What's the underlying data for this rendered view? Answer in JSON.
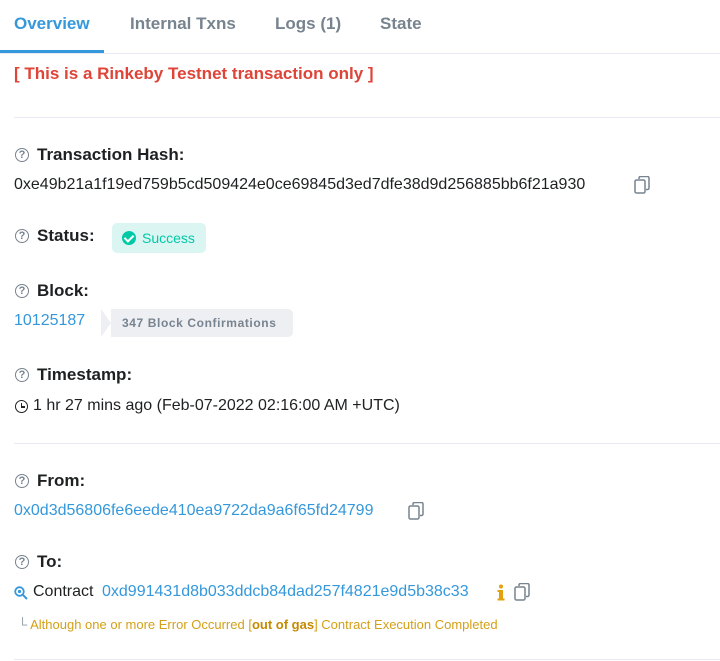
{
  "tabs": [
    {
      "label": "Overview",
      "active": true
    },
    {
      "label": "Internal Txns",
      "active": false
    },
    {
      "label": "Logs (1)",
      "active": false
    },
    {
      "label": "State",
      "active": false
    }
  ],
  "network_notice": "[ This is a Rinkeby Testnet transaction only ]",
  "fields": {
    "tx_hash": {
      "label": "Transaction Hash:",
      "value": "0xe49b21a1f19ed759b5cd509424e0ce69845d3ed7dfe38d9d256885bb6f21a930"
    },
    "status": {
      "label": "Status:",
      "value": "Success"
    },
    "block": {
      "label": "Block:",
      "number": "10125187",
      "confirmations": "347 Block Confirmations"
    },
    "timestamp": {
      "label": "Timestamp:",
      "value": "1 hr 27 mins ago (Feb-07-2022 02:16:00 AM +UTC)"
    },
    "from": {
      "label": "From:",
      "address": "0x0d3d56806fe6eede410ea9722da9a6f65fd24799"
    },
    "to": {
      "label": "To:",
      "prefix": "Contract",
      "address": "0xd991431d8b033ddcb84dad257f4821e9d5b38c33",
      "note_branch": "└",
      "note_pre": "Although one or more Error Occurred [",
      "note_error": "out of gas",
      "note_post": "] Contract Execution Completed"
    }
  },
  "colors": {
    "accent": "#3498db",
    "success": "#00c9a7",
    "warning": "#de4437",
    "note": "#d4a017"
  },
  "icons": [
    "question-circle-icon",
    "copy-icon",
    "check-circle-icon",
    "clock-icon",
    "search-contract-icon",
    "info-icon"
  ]
}
